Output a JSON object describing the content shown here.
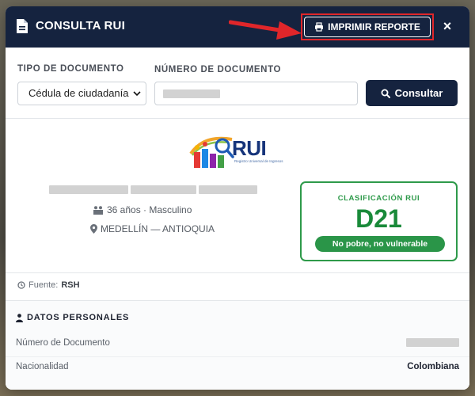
{
  "modal": {
    "title": "CONSULTA RUI",
    "print_button_label": "IMPRIMIR REPORTE",
    "close_symbol": "×"
  },
  "form": {
    "doc_type_label": "TIPO DE DOCUMENTO",
    "doc_type_selected": "Cédula de ciudadanía",
    "doc_number_label": "NÚMERO DE DOCUMENTO",
    "consult_button_label": "Consultar"
  },
  "logo": {
    "text": "RUI",
    "subtitle": "Registro Universal de Ingresos"
  },
  "person": {
    "age_gender": "36 años · Masculino",
    "location": "MEDELLÍN — ANTIOQUIA"
  },
  "classification": {
    "title": "CLASIFICACIÓN RUI",
    "code": "D21",
    "description": "No pobre, no vulnerable"
  },
  "source": {
    "label": "Fuente:",
    "value": "RSH"
  },
  "personal_data": {
    "section_title": "DATOS PERSONALES",
    "rows": [
      {
        "label": "Número de Documento",
        "value": ""
      },
      {
        "label": "Nacionalidad",
        "value": "Colombiana"
      }
    ]
  },
  "icons": {
    "header": "document-icon",
    "print": "printer-icon",
    "close": "close-icon",
    "search": "search-icon",
    "people": "people-icon",
    "location": "map-pin-icon",
    "clock": "clock-icon",
    "person": "person-icon"
  },
  "colors": {
    "header_bg": "#15233f",
    "accent_green": "#2e9a4a",
    "annotation_red": "#e0262a"
  }
}
